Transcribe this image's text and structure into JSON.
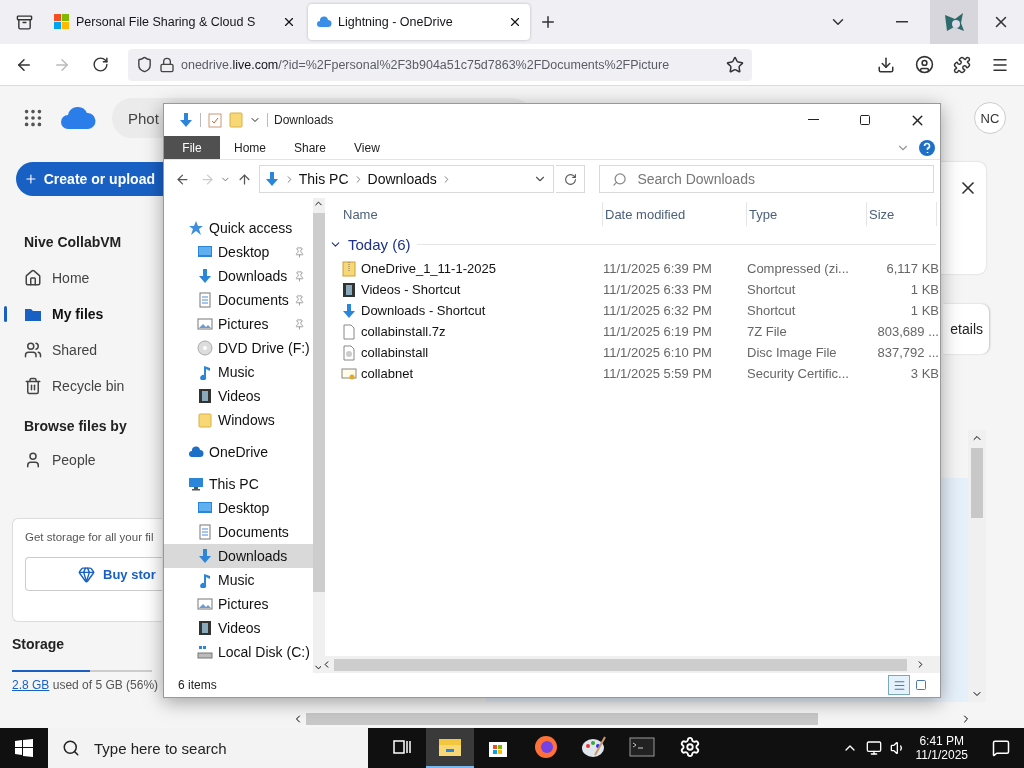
{
  "browser": {
    "tabs": [
      {
        "title": "Personal File Sharing & Cloud S",
        "kind": "microsoft",
        "selected": false
      },
      {
        "title": "Lightning - OneDrive",
        "kind": "cloud",
        "selected": true
      }
    ],
    "url": {
      "prefix": "onedrive.",
      "domain": "live.com",
      "rest": "/?id=%2Fpersonal%2F3b904a51c75d7863%2FDocuments%2FPicture"
    }
  },
  "onedrive": {
    "search_text": "Phot",
    "avatar": "NC",
    "create_button": "Create or upload",
    "account": "Nive CollabVM",
    "nav": [
      {
        "label": "Home",
        "kind": "home",
        "selected": false
      },
      {
        "label": "My files",
        "kind": "folder",
        "selected": true
      },
      {
        "label": "Shared",
        "kind": "people",
        "selected": false
      },
      {
        "label": "Recycle bin",
        "kind": "trash",
        "selected": false
      }
    ],
    "browse_heading": "Browse files by",
    "browse_items": [
      {
        "label": "People",
        "kind": "person"
      }
    ],
    "promo_text": "Get storage for all your fil",
    "buy_button": "Buy stor",
    "storage_heading": "Storage",
    "storage_used": "2.8 GB",
    "storage_text": "used of 5 GB (56%)",
    "storage_bar": {
      "level": 0.56
    },
    "details_button": "etails"
  },
  "explorer": {
    "title": "Downloads",
    "ribbon_tabs": [
      {
        "label": "File",
        "selected": true
      },
      {
        "label": "Home",
        "selected": false
      },
      {
        "label": "Share",
        "selected": false
      },
      {
        "label": "View",
        "selected": false
      }
    ],
    "breadcrumb": [
      "This PC",
      "Downloads"
    ],
    "search_placeholder": "Search Downloads",
    "tree": [
      {
        "label": "Quick access",
        "kind": "star",
        "selected": false,
        "children": [
          {
            "label": "Desktop",
            "kind": "desktop",
            "selected": false,
            "pinned": true
          },
          {
            "label": "Downloads",
            "kind": "download",
            "selected": false,
            "pinned": true
          },
          {
            "label": "Documents",
            "kind": "documents",
            "selected": false,
            "pinned": true
          },
          {
            "label": "Pictures",
            "kind": "pictures",
            "selected": false,
            "pinned": true
          },
          {
            "label": "DVD Drive (F:)",
            "kind": "dvd",
            "selected": false,
            "pinned": false
          },
          {
            "label": "Music",
            "kind": "music",
            "selected": false,
            "pinned": false
          },
          {
            "label": "Videos",
            "kind": "videos",
            "selected": false,
            "pinned": false
          },
          {
            "label": "Windows",
            "kind": "folder",
            "selected": false,
            "pinned": false
          }
        ]
      },
      {
        "label": "OneDrive",
        "kind": "onedrive",
        "selected": false
      },
      {
        "label": "This PC",
        "kind": "pc",
        "selected": false,
        "children": [
          {
            "label": "Desktop",
            "kind": "desktop",
            "selected": false,
            "pinned": false
          },
          {
            "label": "Documents",
            "kind": "documents",
            "selected": false,
            "pinned": false
          },
          {
            "label": "Downloads",
            "kind": "download",
            "selected": true,
            "pinned": false
          },
          {
            "label": "Music",
            "kind": "music",
            "selected": false,
            "pinned": false
          },
          {
            "label": "Pictures",
            "kind": "pictures",
            "selected": false,
            "pinned": false
          },
          {
            "label": "Videos",
            "kind": "videos",
            "selected": false,
            "pinned": false
          },
          {
            "label": "Local Disk (C:)",
            "kind": "disk",
            "selected": false,
            "pinned": false
          }
        ]
      }
    ],
    "columns": [
      "Name",
      "Date modified",
      "Type",
      "Size"
    ],
    "group": "Today (6)",
    "files": [
      {
        "name": "OneDrive_1_11-1-2025",
        "date": "11/1/2025 6:39 PM",
        "type": "Compressed (zi...",
        "size": "6,117 KB",
        "kind": "zip"
      },
      {
        "name": "Videos - Shortcut",
        "date": "11/1/2025 6:33 PM",
        "type": "Shortcut",
        "size": "1 KB",
        "kind": "videos"
      },
      {
        "name": "Downloads - Shortcut",
        "date": "11/1/2025 6:32 PM",
        "type": "Shortcut",
        "size": "1 KB",
        "kind": "download"
      },
      {
        "name": "collabinstall.7z",
        "date": "11/1/2025 6:19 PM",
        "type": "7Z File",
        "size": "803,689 ...",
        "kind": "file"
      },
      {
        "name": "collabinstall",
        "date": "11/1/2025 6:10 PM",
        "type": "Disc Image File",
        "size": "837,792 ...",
        "kind": "disc"
      },
      {
        "name": "collabnet",
        "date": "11/1/2025 5:59 PM",
        "type": "Security Certific...",
        "size": "3 KB",
        "kind": "cert"
      }
    ],
    "status": "6 items"
  },
  "taskbar": {
    "search_placeholder": "Type here to search",
    "apps": [
      {
        "kind": "taskview",
        "selected": false
      },
      {
        "kind": "explorer",
        "selected": true
      },
      {
        "kind": "store",
        "selected": false
      },
      {
        "kind": "firefox",
        "selected": false
      },
      {
        "kind": "paint",
        "selected": false
      },
      {
        "kind": "terminal",
        "selected": false
      },
      {
        "kind": "settings",
        "selected": false
      }
    ],
    "time": "6:41 PM",
    "date": "11/1/2025"
  }
}
